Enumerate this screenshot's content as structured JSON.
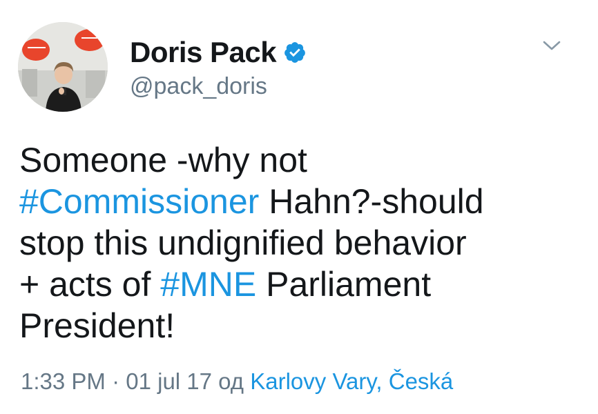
{
  "tweet": {
    "author": {
      "display_name": "Doris Pack",
      "handle": "@pack_doris",
      "verified": true,
      "verified_icon": "verified-badge-icon",
      "verified_color": "#1b95e0"
    },
    "text": {
      "line1": "Someone -why not",
      "hashtag1": "#Commissioner",
      "line2_rest": " Hahn?-should",
      "line3": "stop this undignified behavior",
      "line4_pre": "+ acts of ",
      "hashtag2": "#MNE",
      "line4_post": " Parliament",
      "line5": "President!"
    },
    "meta": {
      "time": "1:33 PM",
      "separator": " · ",
      "date": "01 jul 17",
      "from_label": " од ",
      "location": "Karlovy Vary, Česká"
    },
    "colors": {
      "text": "#14171a",
      "secondary": "#657786",
      "link": "#1b95e0"
    },
    "menu_icon": "chevron-down-icon"
  }
}
